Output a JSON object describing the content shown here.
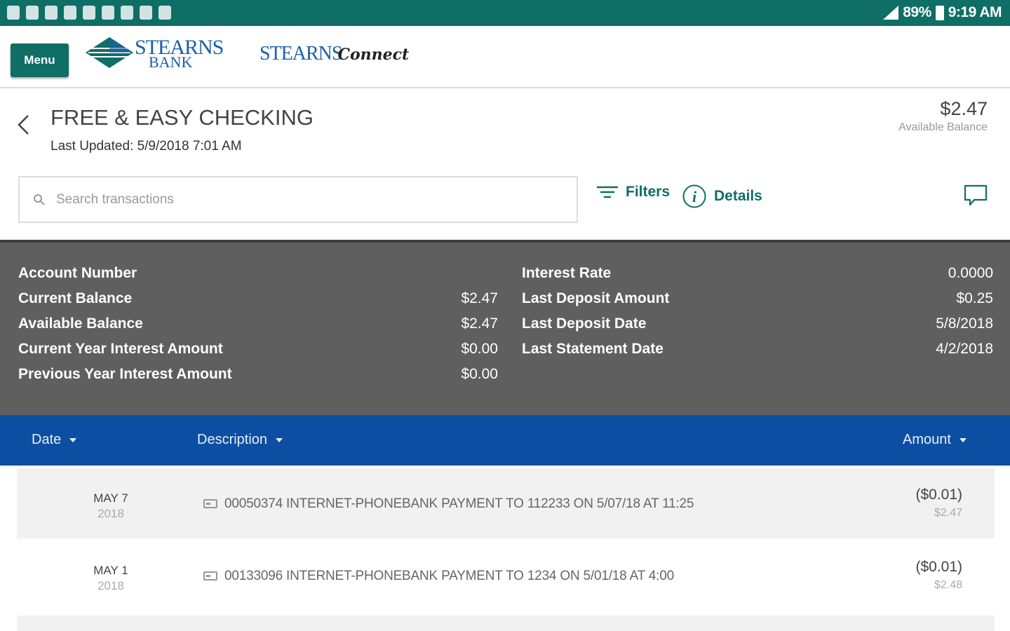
{
  "status_bar": {
    "battery": "89%",
    "time": "9:19 AM"
  },
  "header": {
    "menu_label": "Menu",
    "logo_line1": "STEARNS",
    "logo_line2": "BANK",
    "connect_brand_1": "STEARNS",
    "connect_brand_2": "Connect"
  },
  "account": {
    "title": "FREE & EASY CHECKING",
    "last_updated": "Last Updated: 5/9/2018 7:01 AM",
    "balance": "$2.47",
    "balance_label": "Available Balance"
  },
  "search": {
    "placeholder": "Search transactions",
    "filters_label": "Filters",
    "details_label": "Details"
  },
  "details_panel": {
    "left": [
      {
        "label": "Account Number",
        "value": ""
      },
      {
        "label": "Current Balance",
        "value": "$2.47"
      },
      {
        "label": "Available Balance",
        "value": "$2.47"
      },
      {
        "label": "Current Year Interest Amount",
        "value": "$0.00"
      },
      {
        "label": "Previous Year Interest Amount",
        "value": "$0.00"
      }
    ],
    "right": [
      {
        "label": "Interest Rate",
        "value": "0.0000"
      },
      {
        "label": "Last Deposit Amount",
        "value": "$0.25"
      },
      {
        "label": "Last Deposit Date",
        "value": "5/8/2018"
      },
      {
        "label": "Last Statement Date",
        "value": "4/2/2018"
      }
    ]
  },
  "table": {
    "columns": [
      "Date",
      "Description",
      "Amount"
    ],
    "transactions": [
      {
        "month_day": "MAY 7",
        "year": "2018",
        "description": "00050374 INTERNET-PHONEBANK PAYMENT TO 112233 ON 5/07/18 AT 11:25",
        "amount": "($0.01)",
        "running_balance": "$2.47"
      },
      {
        "month_day": "MAY 1",
        "year": "2018",
        "description": "00133096 INTERNET-PHONEBANK PAYMENT TO 1234 ON 5/01/18 AT 4:00",
        "amount": "($0.01)",
        "running_balance": "$2.48"
      }
    ]
  },
  "colors": {
    "brand_teal": "#0f6e66",
    "brand_blue": "#1a5fa8",
    "table_header": "#0c4fa2",
    "details_bg": "#5f5f5f"
  },
  "icons": [
    "back-chevron-icon",
    "search-icon",
    "filter-icon",
    "info-icon",
    "chat-icon",
    "transaction-card-icon"
  ]
}
